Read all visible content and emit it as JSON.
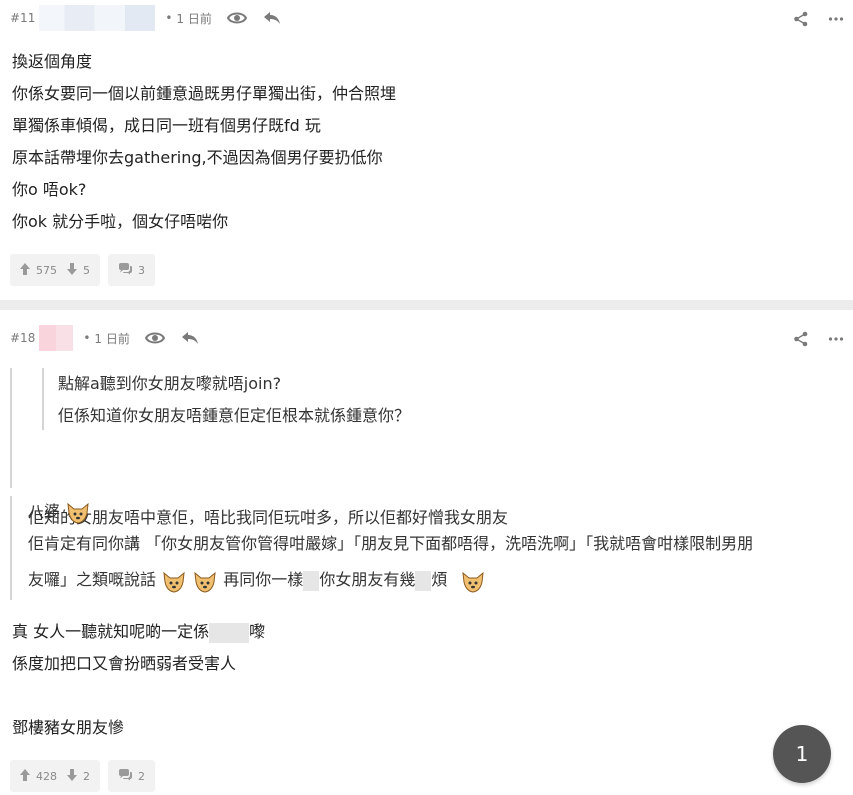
{
  "posts": [
    {
      "floor": "#11",
      "dot": "•",
      "time": "1 日前",
      "lines": [
        "換返個角度",
        "你係女要同一個以前鍾意過既男仔單獨出街，仲合照埋",
        "單獨係車傾偈，成日同一班有個男仔既fd 玩",
        "原本話帶埋你去gathering,不過因為個男仔要扔低你",
        "你o 唔ok?",
        "你ok 就分手啦，個女仔唔啱你"
      ],
      "upvotes": "575",
      "downvotes": "5",
      "comments": "3"
    },
    {
      "floor": "#18",
      "dot": "•",
      "time": "1 日前",
      "quote_level2": [
        "點解a聽到你女朋友嚟就唔join?",
        "佢係知道你女朋友唔鍾意佢定佢根本就係鍾意你？"
      ],
      "quote_level1": "佢知的女朋友唔中意佢，唔比我同佢玩咁多，所以佢都好憎我女朋友",
      "sec_quote": {
        "line1": "八婆",
        "line2": "佢肯定有同你講 「你女朋友管你管得咁嚴嫁」「朋友見下面都唔得，洗唔洗啊」「我就唔會咁樣限制男朋",
        "line3_a": "友囉」之類嘅說話",
        "line3_b": "再同你一樣",
        "line3_c": "你女朋友有幾",
        "line3_d": "煩"
      },
      "body": {
        "line1_a": "真 女人一聽就知呢啲一定係",
        "line1_b": "嚟",
        "line2": "係度加把口又會扮晒弱者受害人",
        "line3": "",
        "line4": "鄧樓豬女朋友慘"
      },
      "upvotes": "428",
      "downvotes": "2",
      "comments": "2"
    }
  ],
  "page_indicator": "1",
  "icons": {
    "view": "eye-icon",
    "reply": "reply-arrow-icon",
    "share": "share-icon",
    "more": "more-dots-icon",
    "upvote": "thumb-up-arrow-icon",
    "downvote": "thumb-down-arrow-icon",
    "comment": "speech-bubble-icon",
    "emoji": "dog-face-emoji-icon"
  },
  "colors": {
    "separator": "#ececec",
    "meta_text": "#7a7a7a",
    "fab": "#555555",
    "stat_bg": "#f2f2f2"
  }
}
